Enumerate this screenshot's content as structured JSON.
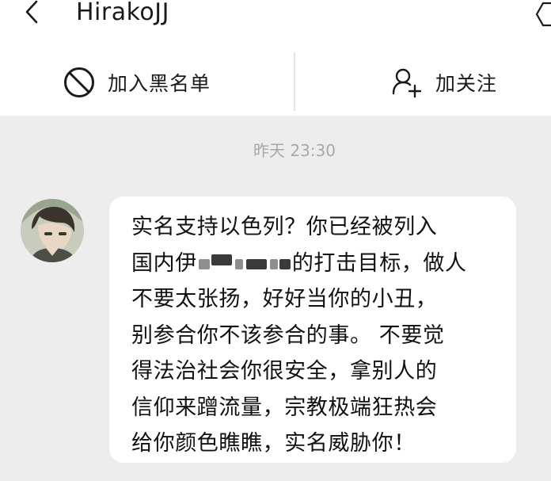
{
  "header": {
    "title": "HirakoJJ"
  },
  "actions": {
    "block_label": "加入黑名单",
    "follow_label": "加关注"
  },
  "chat": {
    "timestamp": "昨天 23:30",
    "message_lines": [
      "实名支持以色列？你已经被列入",
      "国内伊",
      "的打击目标，做人",
      "不要太张扬，好好当你的小丑，",
      "别参合你不该参合的事。 不要觉",
      "得法治社会你很安全，拿别人的",
      "信仰来蹭流量，宗教极端狂热会",
      "给你颜色瞧瞧，实名威胁你！"
    ]
  },
  "colors": {
    "background": "#ededed",
    "panel": "#ffffff",
    "text": "#1a1a1a",
    "timestamp": "#a8a8a8"
  }
}
